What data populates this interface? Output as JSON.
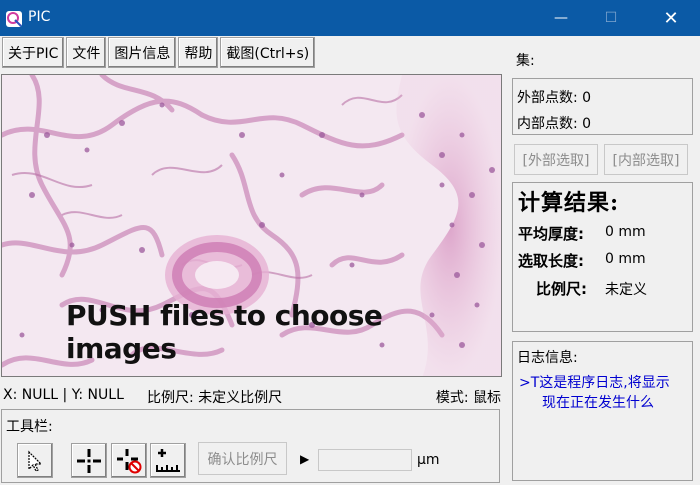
{
  "window": {
    "title": "PIC",
    "minimize": "—",
    "maximize": "☐",
    "close": "✕"
  },
  "menu": {
    "about": "关于PIC",
    "file": "文件",
    "image_info": "图片信息",
    "help": "帮助",
    "screenshot": "截图(Ctrl+s)"
  },
  "canvas": {
    "prompt": "PUSH files to choose images"
  },
  "status": {
    "coords": "X: NULL | Y: NULL",
    "scale_label": "比例尺:",
    "scale_value": "未定义比例尺",
    "mode_label": "模式:",
    "mode_value": "鼠标"
  },
  "toolbar": {
    "label": "工具栏:",
    "tools": [
      "pointer-icon",
      "crosshair-icon",
      "crosshair-cancel-icon",
      "ruler-icon"
    ],
    "confirm_scale": "确认比例尺",
    "arrow": "▶",
    "scale_input_value": "",
    "unit": "μm"
  },
  "panel": {
    "set_label": "集:",
    "outer_points_label": "外部点数:",
    "outer_points_value": "0",
    "inner_points_label": "内部点数:",
    "inner_points_value": "0",
    "outer_select": "[外部选取]",
    "inner_select": "[内部选取]",
    "result_title": "计算结果:",
    "avg_thickness_label": "平均厚度:",
    "avg_thickness_value": "0 mm",
    "length_label": "选取长度:",
    "length_value": "0 mm",
    "scale_label": "比例尺:",
    "scale_value": "未定义",
    "log_label": "日志信息:",
    "log_line1": ">T这是程序日志,将显示",
    "log_line2": "现在正在发生什么"
  },
  "colors": {
    "titlebar": "#0b5aa6",
    "log_text": "#0000d0",
    "tissue_background": "#f3e6f0",
    "tissue_stain": "#c88ab5"
  }
}
